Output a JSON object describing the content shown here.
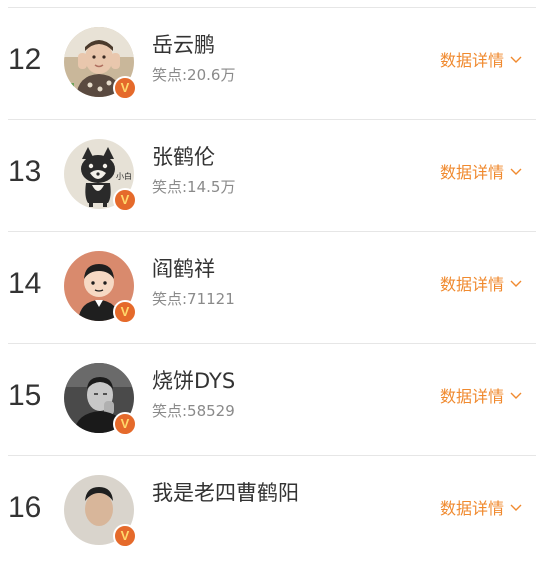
{
  "rows": [
    {
      "rank": "12",
      "name": "岳云鹏",
      "score": "笑点:20.6万",
      "detail_label": "数据详情"
    },
    {
      "rank": "13",
      "name": "张鹤伦",
      "score": "笑点:14.5万",
      "detail_label": "数据详情"
    },
    {
      "rank": "14",
      "name": "阎鹤祥",
      "score": "笑点:71121",
      "detail_label": "数据详情"
    },
    {
      "rank": "15",
      "name": "烧饼DYS",
      "score": "笑点:58529",
      "detail_label": "数据详情"
    },
    {
      "rank": "16",
      "name": "我是老四曹鹤阳",
      "score": "",
      "detail_label": "数据详情"
    }
  ],
  "badge_text": "V",
  "colors": {
    "accent": "#f08a2f",
    "badge": "#e56a2b",
    "text": "#333333",
    "muted": "#8a8a8a",
    "divider": "#e6e6e6"
  },
  "icons": {
    "badge": "verified-badge-icon",
    "expand": "chevron-down-icon"
  }
}
